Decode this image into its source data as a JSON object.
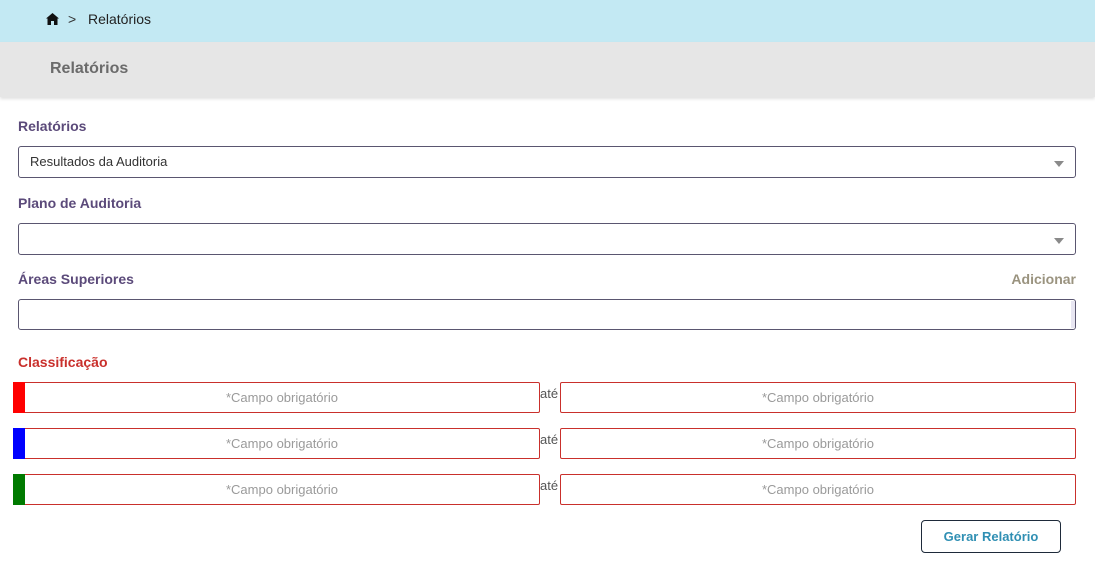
{
  "breadcrumb": {
    "home_icon": "home-icon",
    "separator": ">",
    "current": "Relatórios"
  },
  "header": {
    "title": "Relatórios"
  },
  "form": {
    "report": {
      "label": "Relatórios",
      "selected": "Resultados da Auditoria"
    },
    "audit_plan": {
      "label": "Plano de Auditoria",
      "selected": ""
    },
    "upper_areas": {
      "label": "Áreas Superiores",
      "add_label": "Adicionar",
      "value": ""
    },
    "classification": {
      "label": "Classificação",
      "separator": "até",
      "rows": [
        {
          "color": "#ff0000",
          "from_placeholder": "*Campo obrigatório",
          "to_placeholder": "*Campo obrigatório"
        },
        {
          "color": "#0000ff",
          "from_placeholder": "*Campo obrigatório",
          "to_placeholder": "*Campo obrigatório"
        },
        {
          "color": "#007a00",
          "from_placeholder": "*Campo obrigatório",
          "to_placeholder": "*Campo obrigatório"
        }
      ]
    },
    "generate_button": "Gerar Relatório"
  },
  "colors": {
    "breadcrumb_bg": "#c3e9f3",
    "label_purple": "#5b4a7a",
    "required_red": "#c9302c",
    "button_text": "#2f8fb3"
  }
}
